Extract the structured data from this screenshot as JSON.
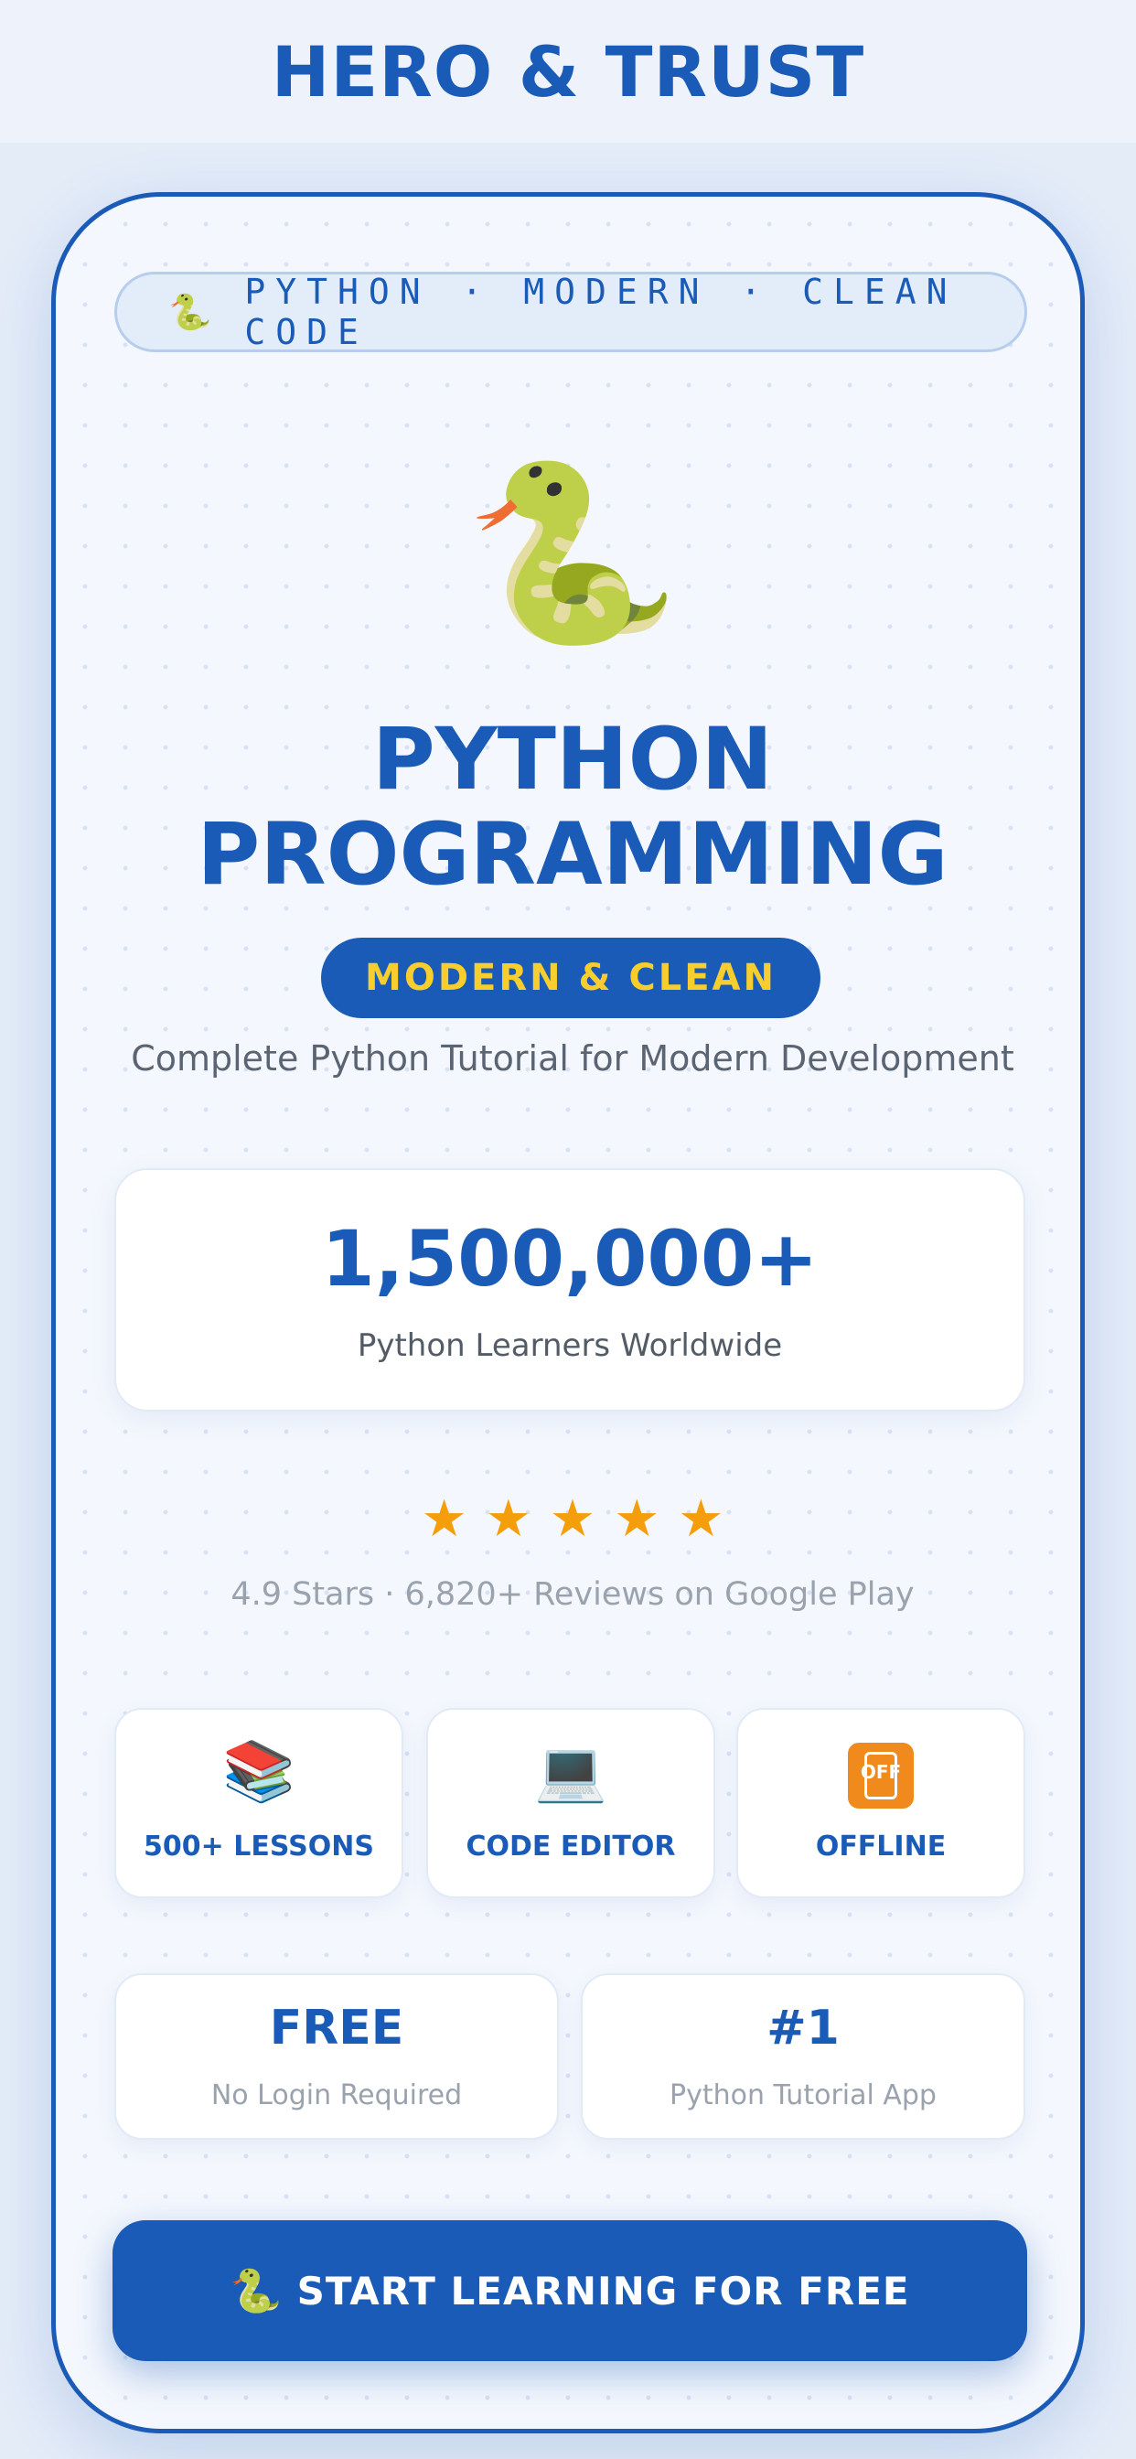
{
  "header": {
    "title": "HERO & TRUST"
  },
  "tagline_pill": {
    "icon": "🐍",
    "text": "PYTHON · MODERN · CLEAN CODE"
  },
  "hero": {
    "icon": "🐍",
    "title_line1": "PYTHON",
    "title_line2": "PROGRAMMING",
    "badge": "MODERN & CLEAN",
    "subtitle": "Complete Python Tutorial for Modern Development"
  },
  "stat": {
    "number": "1,500,000+",
    "label": "Python Learners Worldwide"
  },
  "rating": {
    "stars": [
      "★",
      "★",
      "★",
      "★",
      "★"
    ],
    "text": "4.9 Stars · 6,820+ Reviews on Google Play"
  },
  "features": [
    {
      "icon": "📚",
      "icon_name": "books-icon",
      "label": "500+ LESSONS"
    },
    {
      "icon": "💻",
      "icon_name": "laptop-icon",
      "label": "CODE EDITOR"
    },
    {
      "icon": "OFF",
      "icon_name": "mobile-off-icon",
      "label": "OFFLINE"
    }
  ],
  "info_cards": [
    {
      "value": "FREE",
      "label": "No Login Required"
    },
    {
      "value": "#1",
      "label": "Python Tutorial App"
    }
  ],
  "cta": {
    "icon": "🐍",
    "label": "START LEARNING FOR FREE"
  },
  "colors": {
    "primary": "#1a5bb8",
    "accent_yellow": "#f7ce2d",
    "star": "#f59e0b",
    "background": "#f4f7fd"
  }
}
